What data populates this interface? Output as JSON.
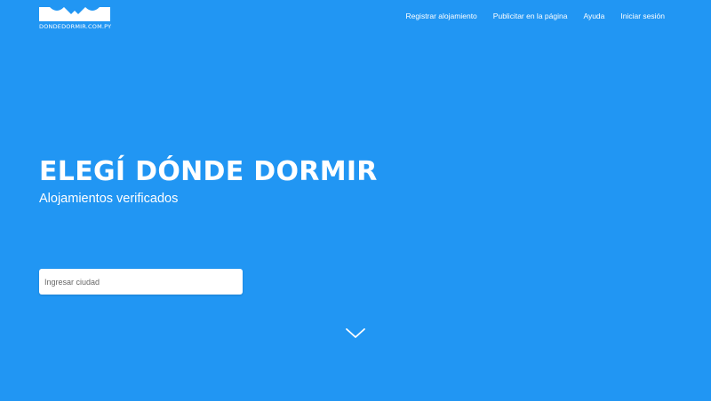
{
  "header": {
    "logo_text": "DONDEDORMIR.COM.PY",
    "nav": [
      {
        "label": "Registrar alojamiento"
      },
      {
        "label": "Publicitar en la página"
      },
      {
        "label": "Ayuda"
      },
      {
        "label": "Iniciar sesión"
      }
    ]
  },
  "hero": {
    "title": "ELEGÍ DÓNDE DORMIR",
    "subtitle": "Alojamientos verificados"
  },
  "search": {
    "placeholder": "Ingresar ciudad",
    "value": ""
  },
  "icons": {
    "logo": "house-roof-logo-icon",
    "scroll_down": "chevron-down-icon"
  },
  "colors": {
    "background": "#2196F3",
    "text": "#ffffff",
    "input_background": "#ffffff"
  }
}
